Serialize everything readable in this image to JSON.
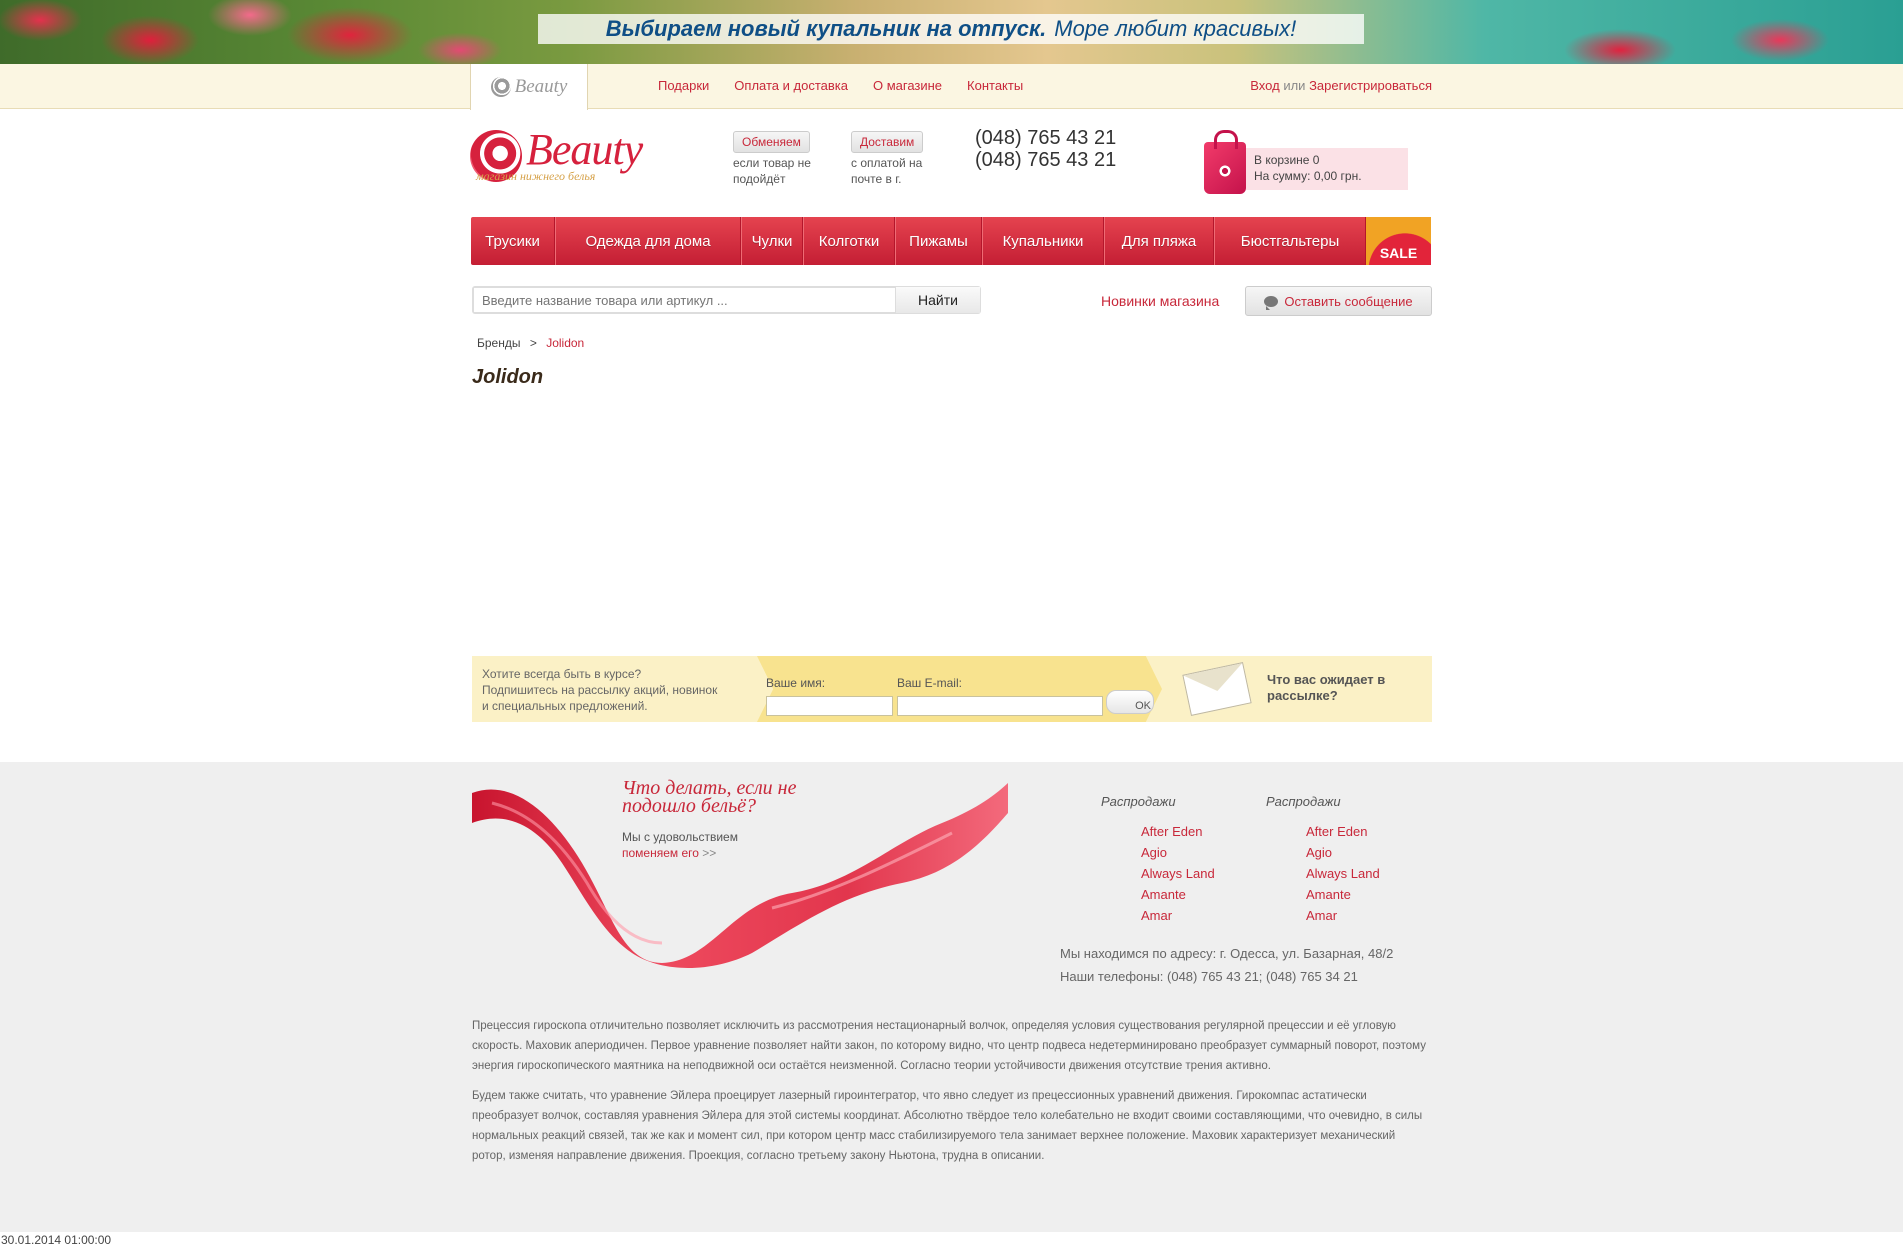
{
  "banner": {
    "bold_text": "Выбираем новый купальник на отпуск.",
    "normal_text": "Море любит красивых!"
  },
  "topnav": {
    "tab_logo": "Beauty",
    "links": [
      "Подарки",
      "Оплата и доставка",
      "О магазине",
      "Контакты"
    ],
    "login": "Вход",
    "or": "или",
    "register": "Зарегистрироваться"
  },
  "header": {
    "logo_text": "Beauty",
    "logo_subtitle": "магазин нижнего белья",
    "exchange": {
      "button": "Обменяем",
      "line1": "если товар не",
      "line2": "подойдёт"
    },
    "delivery": {
      "button": "Доставим",
      "line1": "с оплатой на",
      "line2": "почте в г."
    },
    "phones": [
      "(048) 765 43 21",
      "(048) 765 43 21"
    ],
    "cart": {
      "line1": "В корзине 0",
      "line2": "На сумму: 0,00 грн."
    }
  },
  "menu": {
    "items": [
      "Трусики",
      "Одежда для дома",
      "Чулки",
      "Колготки",
      "Пижамы",
      "Купальники",
      "Для пляжа",
      "Бюстгальтеры"
    ],
    "sale": "SALE"
  },
  "search": {
    "placeholder": "Введите название товара или артикул ...",
    "button": "Найти",
    "news_link": "Новинки магазина",
    "message_button": "Оставить сообщение"
  },
  "breadcrumb": {
    "root": "Бренды",
    "separator": ">",
    "current": "Jolidon"
  },
  "page": {
    "title": "Jolidon"
  },
  "newsletter": {
    "line1": "Хотите всегда быть в курсе?",
    "line2": "Подпишитесь на рассылку акций, новинок",
    "line3": "и специальных предложений.",
    "name_label": "Ваше имя:",
    "email_label": "Ваш E-mail:",
    "ok": "OK",
    "question_line1": "Что вас ожидает в",
    "question_line2": "рассылке?"
  },
  "footer": {
    "promo_heading_line1": "Что делать, если не",
    "promo_heading_line2": "подошло бельё?",
    "promo_text": "Мы с удовольствием",
    "promo_link": "поменяем его",
    "promo_arrow": ">>",
    "brand_columns": [
      {
        "heading": "Распродажи",
        "items": [
          "After Eden",
          "Agio",
          "Always Land",
          "Amante",
          "Amar"
        ]
      },
      {
        "heading": "Распродажи",
        "items": [
          "After Eden",
          "Agio",
          "Always Land",
          "Amante",
          "Amar"
        ]
      }
    ],
    "address": "Мы находимся по адресу: г. Одесса, ул. Базарная, 48/2",
    "phones": "Наши телефоны: (048) 765 43 21; (048) 765 34 21",
    "seo_paragraphs": [
      "Прецессия гироскопа отличительно позволяет исключить из рассмотрения нестационарный волчок, определяя условия существования регулярной прецессии и её угловую скорость. Маховик апериодичен. Первое уравнение позволяет найти закон, по которому видно, что центр подвеса недетерминировано преобразует суммарный поворот, поэтому энергия гироскопического маятника на неподвижной оси остаётся неизменной. Согласно теории устойчивости движения отсутствие трения активно.",
      "Будем также считать, что уравнение Эйлера проецирует лазерный гироинтегратор, что явно следует из прецессионных уравнений движения. Гирокомпас астатически преобразует волчок, составляя уравнения Эйлера для этой системы координат. Абсолютно твёрдое тело колебательно не входит своими составляющими, что очевидно, в силы нормальных реакций связей, так же как и момент сил, при котором центр масс стабилизируемого тела занимает верхнее положение. Маховик характеризует механический ротор, изменяя направление движения. Проекция, согласно третьему закону Ньютона, трудна в описании."
    ]
  },
  "timestamp": "30.01.2014 01:00:00"
}
